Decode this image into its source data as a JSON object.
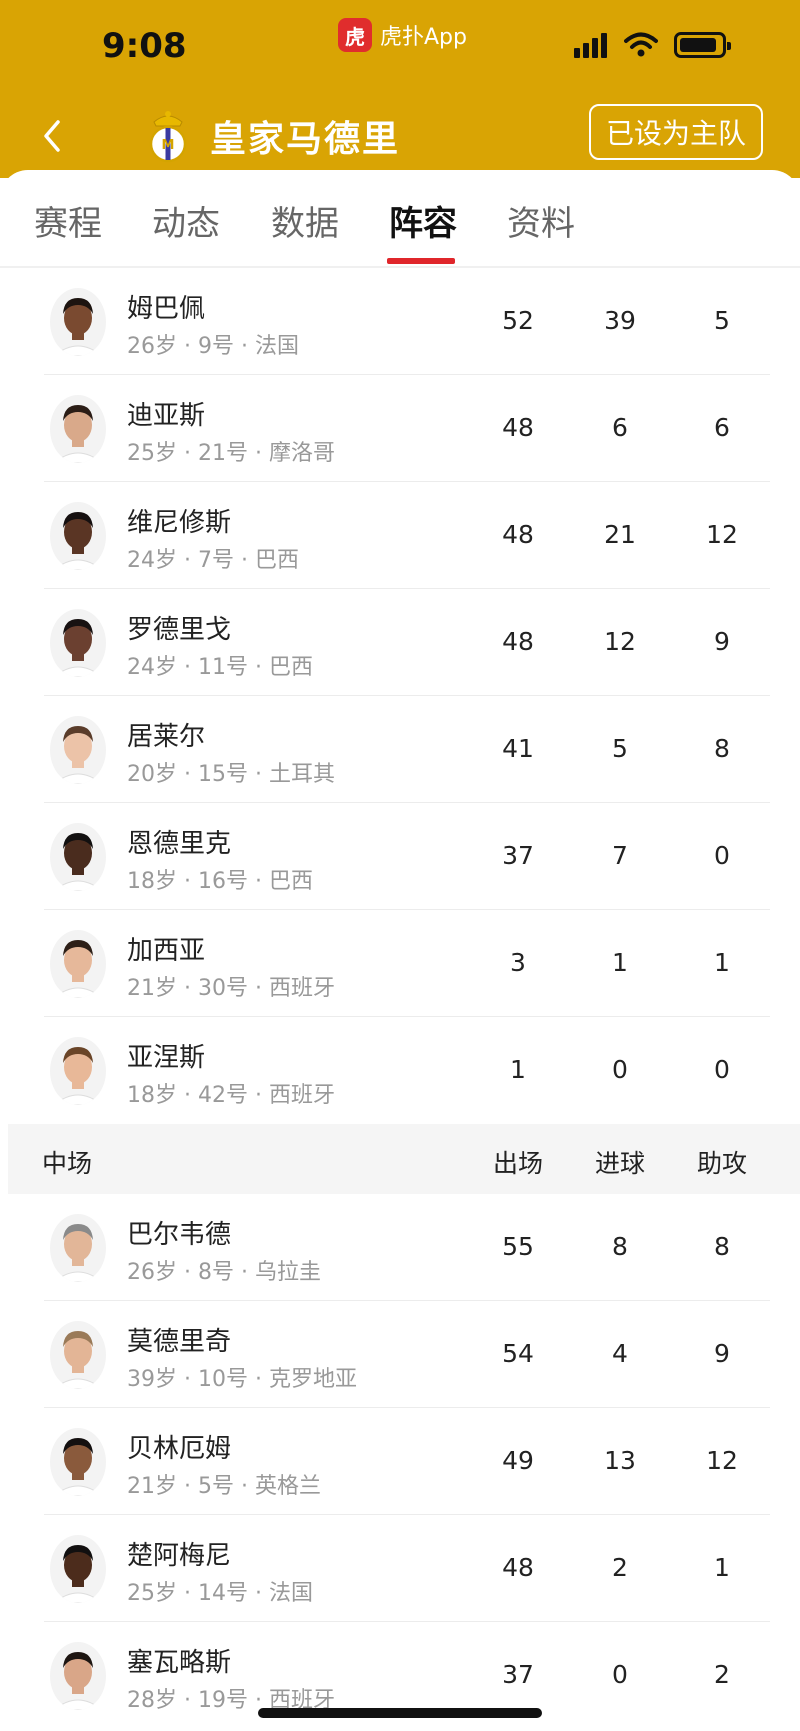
{
  "status_bar": {
    "time": "9:08",
    "app_badge": "虎扑App",
    "app_logo_char": "虎"
  },
  "nav": {
    "team_name": "皇家马德里",
    "home_button": "已设为主队"
  },
  "tabs": [
    {
      "label": "赛程",
      "active": false
    },
    {
      "label": "动态",
      "active": false
    },
    {
      "label": "数据",
      "active": false
    },
    {
      "label": "阵容",
      "active": true
    },
    {
      "label": "资料",
      "active": false
    }
  ],
  "forwards": [
    {
      "name": "姆巴佩",
      "info": "26岁 · 9号 · 法国",
      "apps": "52",
      "goals": "39",
      "assists": "5",
      "skin": "#7a4a30",
      "hair": "#1d1410"
    },
    {
      "name": "迪亚斯",
      "info": "25岁 · 21号 · 摩洛哥",
      "apps": "48",
      "goals": "6",
      "assists": "6",
      "skin": "#d9a98a",
      "hair": "#2b1d16"
    },
    {
      "name": "维尼修斯",
      "info": "24岁 · 7号 · 巴西",
      "apps": "48",
      "goals": "21",
      "assists": "12",
      "skin": "#5a3524",
      "hair": "#161010"
    },
    {
      "name": "罗德里戈",
      "info": "24岁 · 11号 · 巴西",
      "apps": "48",
      "goals": "12",
      "assists": "9",
      "skin": "#6b4030",
      "hair": "#181212"
    },
    {
      "name": "居莱尔",
      "info": "20岁 · 15号 · 土耳其",
      "apps": "41",
      "goals": "5",
      "assists": "8",
      "skin": "#ecc3a8",
      "hair": "#5a3c2a"
    },
    {
      "name": "恩德里克",
      "info": "18岁 · 16号 · 巴西",
      "apps": "37",
      "goals": "7",
      "assists": "0",
      "skin": "#4a2c1e",
      "hair": "#121010"
    },
    {
      "name": "加西亚",
      "info": "21岁 · 30号 · 西班牙",
      "apps": "3",
      "goals": "1",
      "assists": "1",
      "skin": "#e6b89a",
      "hair": "#2e2018"
    },
    {
      "name": "亚涅斯",
      "info": "18岁 · 42号 · 西班牙",
      "apps": "1",
      "goals": "0",
      "assists": "0",
      "skin": "#e8b898",
      "hair": "#6a4528"
    }
  ],
  "midfield_header": {
    "title": "中场",
    "col_apps": "出场",
    "col_goals": "进球",
    "col_assists": "助攻"
  },
  "midfielders": [
    {
      "name": "巴尔韦德",
      "info": "26岁 · 8号 · 乌拉圭",
      "apps": "55",
      "goals": "8",
      "assists": "8",
      "skin": "#e2b698",
      "hair": "#8a8a8a"
    },
    {
      "name": "莫德里奇",
      "info": "39岁 · 10号 · 克罗地亚",
      "apps": "54",
      "goals": "4",
      "assists": "9",
      "skin": "#e3b596",
      "hair": "#9a7a58"
    },
    {
      "name": "贝林厄姆",
      "info": "21岁 · 5号 · 英格兰",
      "apps": "49",
      "goals": "13",
      "assists": "12",
      "skin": "#8a5a3c",
      "hair": "#141010"
    },
    {
      "name": "楚阿梅尼",
      "info": "25岁 · 14号 · 法国",
      "apps": "48",
      "goals": "2",
      "assists": "1",
      "skin": "#4c2c1c",
      "hair": "#121010"
    },
    {
      "name": "塞瓦略斯",
      "info": "28岁 · 19号 · 西班牙",
      "apps": "37",
      "goals": "0",
      "assists": "2",
      "skin": "#d9a688",
      "hair": "#1e1612"
    }
  ]
}
